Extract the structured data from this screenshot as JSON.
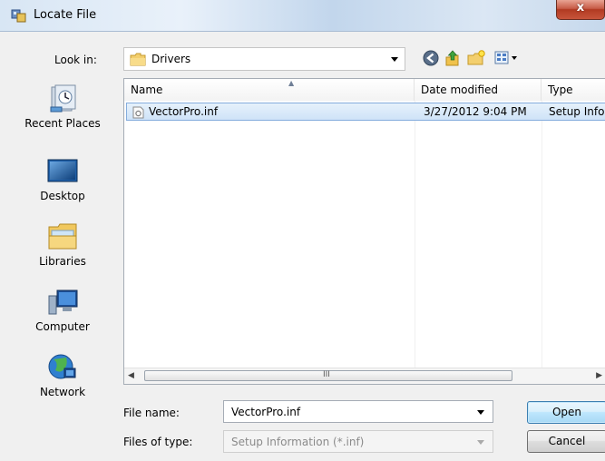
{
  "window": {
    "title": "Locate File",
    "close_label": "x"
  },
  "toolbar": {
    "look_in_label": "Look in:",
    "look_in_value": "Drivers",
    "buttons": [
      "back-icon",
      "up-folder-icon",
      "new-folder-icon",
      "views-menu-icon"
    ]
  },
  "places": [
    {
      "label": "Recent Places",
      "icon": "recent-places-icon"
    },
    {
      "label": "Desktop",
      "icon": "desktop-icon"
    },
    {
      "label": "Libraries",
      "icon": "libraries-icon"
    },
    {
      "label": "Computer",
      "icon": "computer-icon"
    },
    {
      "label": "Network",
      "icon": "network-icon"
    }
  ],
  "list": {
    "columns": [
      "Name",
      "Date modified",
      "Type"
    ],
    "rows": [
      {
        "name": "VectorPro.inf",
        "date": "3/27/2012 9:04 PM",
        "type": "Setup Info"
      }
    ],
    "scroll_grip": "III"
  },
  "form": {
    "file_name_label": "File name:",
    "file_name_value": "VectorPro.inf",
    "file_type_label": "Files of type:",
    "file_type_value": "Setup Information (*.inf)"
  },
  "buttons": {
    "open": "Open",
    "cancel": "Cancel"
  },
  "colors": {
    "selection_fill": "#cfe3f8",
    "selection_border": "#84acdd",
    "close_red": "#c75b46"
  }
}
